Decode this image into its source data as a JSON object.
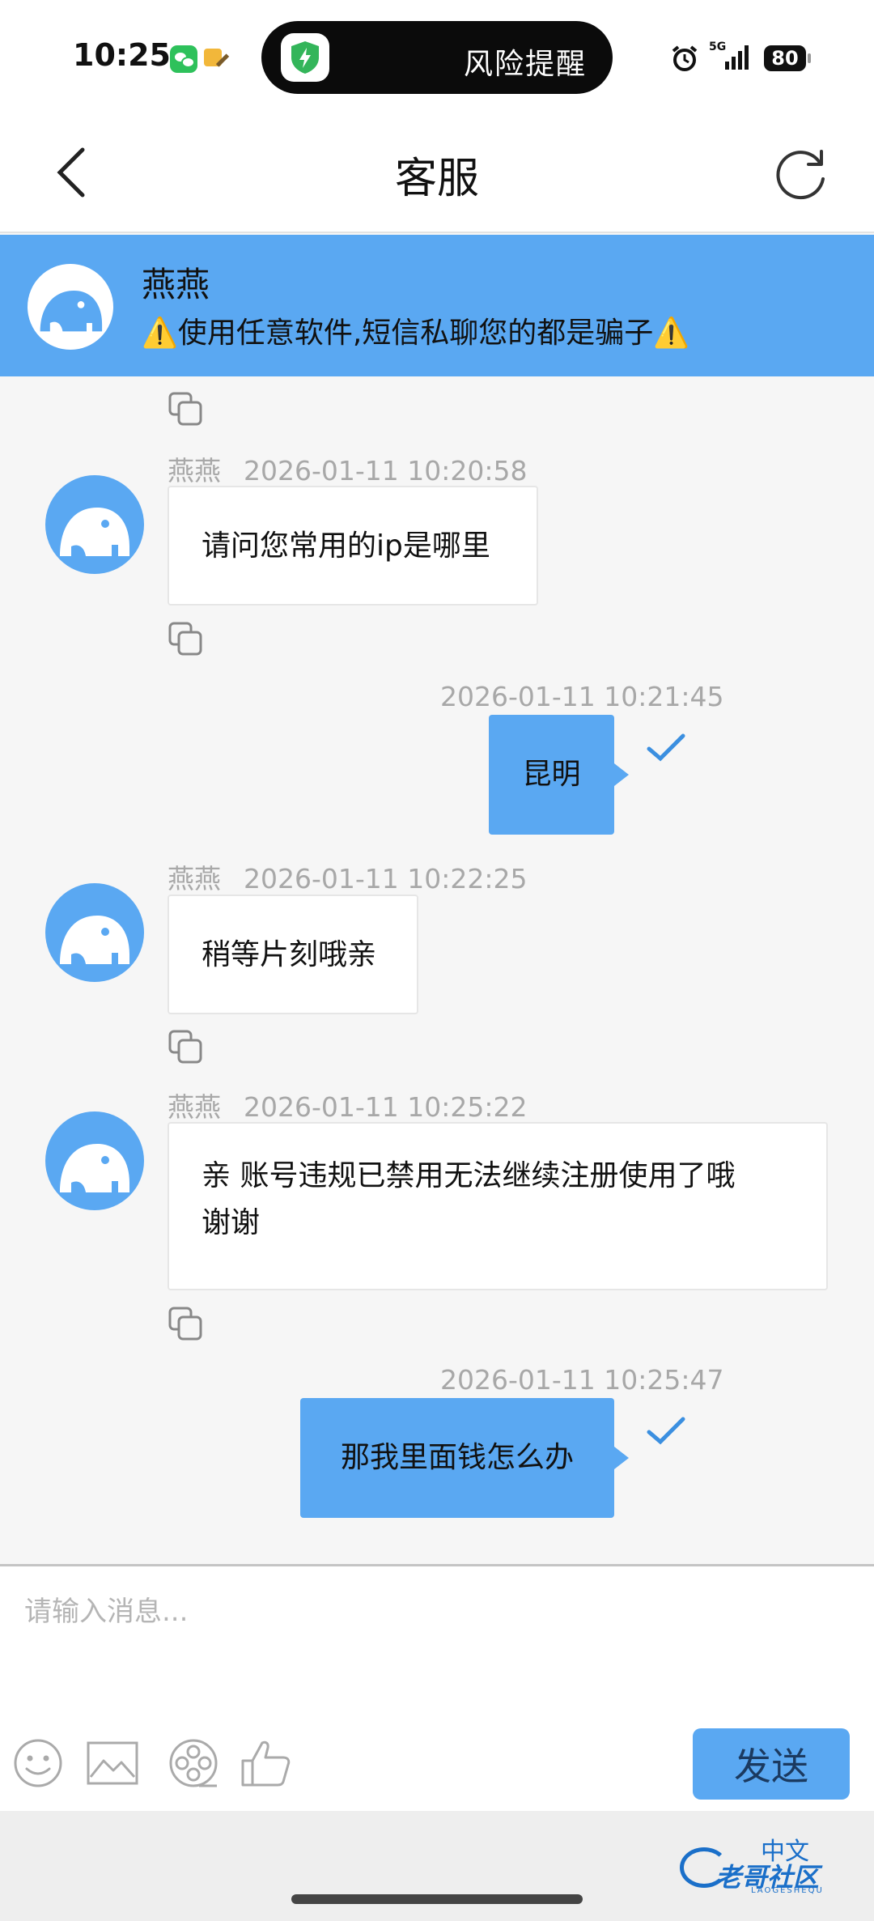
{
  "status_bar": {
    "time": "10:25",
    "island_text": "风险提醒",
    "network": "5G",
    "battery": "80",
    "icons": [
      "wechat-icon",
      "app-icon",
      "shield-icon",
      "alarm-icon",
      "signal-icon"
    ]
  },
  "header": {
    "title": "客服",
    "back_icon": "chevron-left-icon",
    "refresh_icon": "refresh-icon"
  },
  "agent_banner": {
    "name": "燕燕",
    "warning": "⚠️使用任意软件,短信私聊您的都是骗子⚠️"
  },
  "messages": [
    {
      "direction": "in",
      "sender": "燕燕",
      "time": "2026-01-11 10:20:58",
      "text": "请问您常用的ip是哪里"
    },
    {
      "direction": "out",
      "time": "2026-01-11 10:21:45",
      "text": "昆明"
    },
    {
      "direction": "in",
      "sender": "燕燕",
      "time": "2026-01-11 10:22:25",
      "text": "稍等片刻哦亲"
    },
    {
      "direction": "in",
      "sender": "燕燕",
      "time": "2026-01-11 10:25:22",
      "text_line1": "亲 账号违规已禁用无法继续注册使用了哦",
      "text_line2": "谢谢"
    },
    {
      "direction": "out",
      "time": "2026-01-11 10:25:47",
      "text": "那我里面钱怎么办"
    }
  ],
  "composer": {
    "placeholder": "请输入消息...",
    "send_label": "发送",
    "tools": [
      "emoji-icon",
      "image-icon",
      "video-reel-icon",
      "thumbs-up-icon"
    ]
  },
  "watermark": {
    "top": "中文",
    "main": "老哥社区",
    "sub": "LAOGESHEQU"
  },
  "colors": {
    "accent": "#5aa8f2",
    "background": "#f6f6f6"
  }
}
